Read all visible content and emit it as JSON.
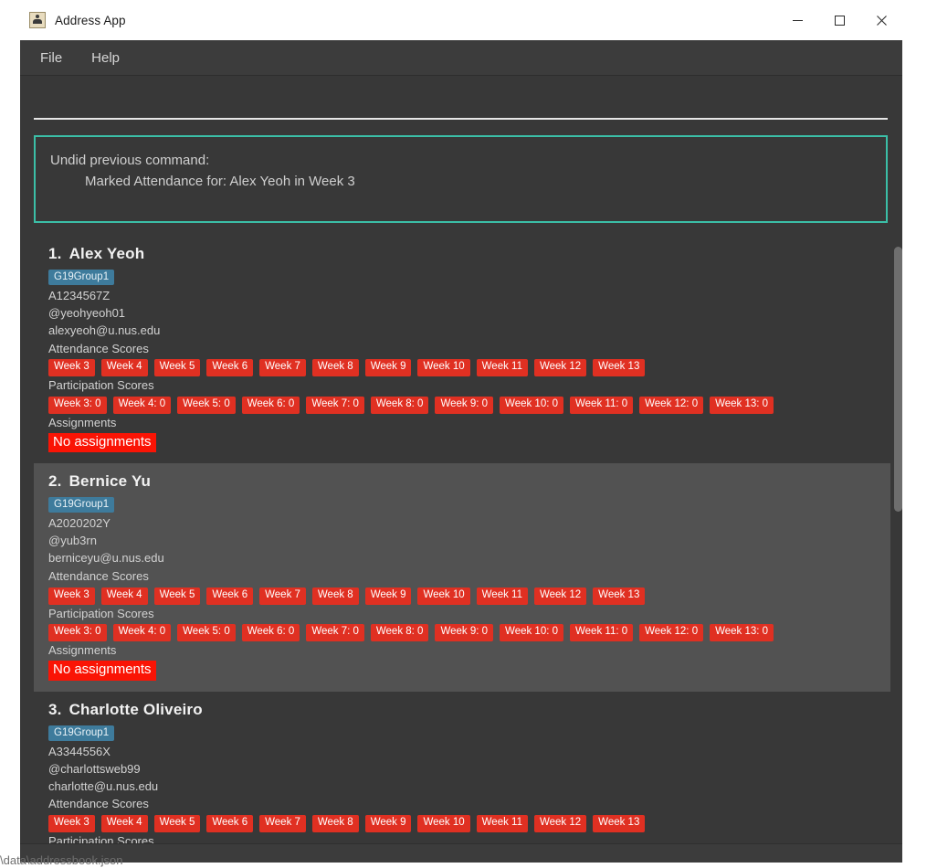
{
  "window": {
    "title": "Address App",
    "icon": "address-book-icon",
    "controls": {
      "minimize": "minimize-icon",
      "maximize": "maximize-icon",
      "close": "close-icon"
    }
  },
  "menu": {
    "items": [
      {
        "label": "File"
      },
      {
        "label": "Help"
      }
    ]
  },
  "command": {
    "value": "",
    "placeholder": ""
  },
  "result": {
    "border_color": "#3bbfa7",
    "line1": "Undid previous command:",
    "line2": "Marked Attendance for: Alex Yeoh in Week 3"
  },
  "colors": {
    "accent": "#3bbfa7",
    "score_tag": "#e03022",
    "assignment_tag": "#fa1405",
    "group_tag": "#3e7b9c",
    "panel_background": "#383838",
    "selected_background": "#525252"
  },
  "labels": {
    "attendance": "Attendance Scores",
    "participation": "Participation Scores",
    "assignments": "Assignments"
  },
  "persons": [
    {
      "index": "1.",
      "name": "Alex Yeoh",
      "group": "G19Group1",
      "student_id": "A1234567Z",
      "handle": "@yeohyeoh01",
      "email": "alexyeoh@u.nus.edu",
      "selected": false,
      "attendance": [
        "Week 3",
        "Week 4",
        "Week 5",
        "Week 6",
        "Week 7",
        "Week 8",
        "Week 9",
        "Week 10",
        "Week 11",
        "Week 12",
        "Week 13"
      ],
      "participation": [
        "Week 3: 0",
        "Week 4: 0",
        "Week 5: 0",
        "Week 6: 0",
        "Week 7: 0",
        "Week 8: 0",
        "Week 9: 0",
        "Week 10: 0",
        "Week 11: 0",
        "Week 12: 0",
        "Week 13: 0"
      ],
      "assignments": "No assignments"
    },
    {
      "index": "2.",
      "name": "Bernice Yu",
      "group": "G19Group1",
      "student_id": "A2020202Y",
      "handle": "@yub3rn",
      "email": "berniceyu@u.nus.edu",
      "selected": true,
      "attendance": [
        "Week 3",
        "Week 4",
        "Week 5",
        "Week 6",
        "Week 7",
        "Week 8",
        "Week 9",
        "Week 10",
        "Week 11",
        "Week 12",
        "Week 13"
      ],
      "participation": [
        "Week 3: 0",
        "Week 4: 0",
        "Week 5: 0",
        "Week 6: 0",
        "Week 7: 0",
        "Week 8: 0",
        "Week 9: 0",
        "Week 10: 0",
        "Week 11: 0",
        "Week 12: 0",
        "Week 13: 0"
      ],
      "assignments": "No assignments"
    },
    {
      "index": "3.",
      "name": "Charlotte Oliveiro",
      "group": "G19Group1",
      "student_id": "A3344556X",
      "handle": "@charlottsweb99",
      "email": "charlotte@u.nus.edu",
      "selected": false,
      "attendance": [
        "Week 3",
        "Week 4",
        "Week 5",
        "Week 6",
        "Week 7",
        "Week 8",
        "Week 9",
        "Week 10",
        "Week 11",
        "Week 12",
        "Week 13"
      ],
      "participation": [],
      "assignments": ""
    }
  ],
  "status": {
    "text": "\\data\\addressbook.json"
  }
}
